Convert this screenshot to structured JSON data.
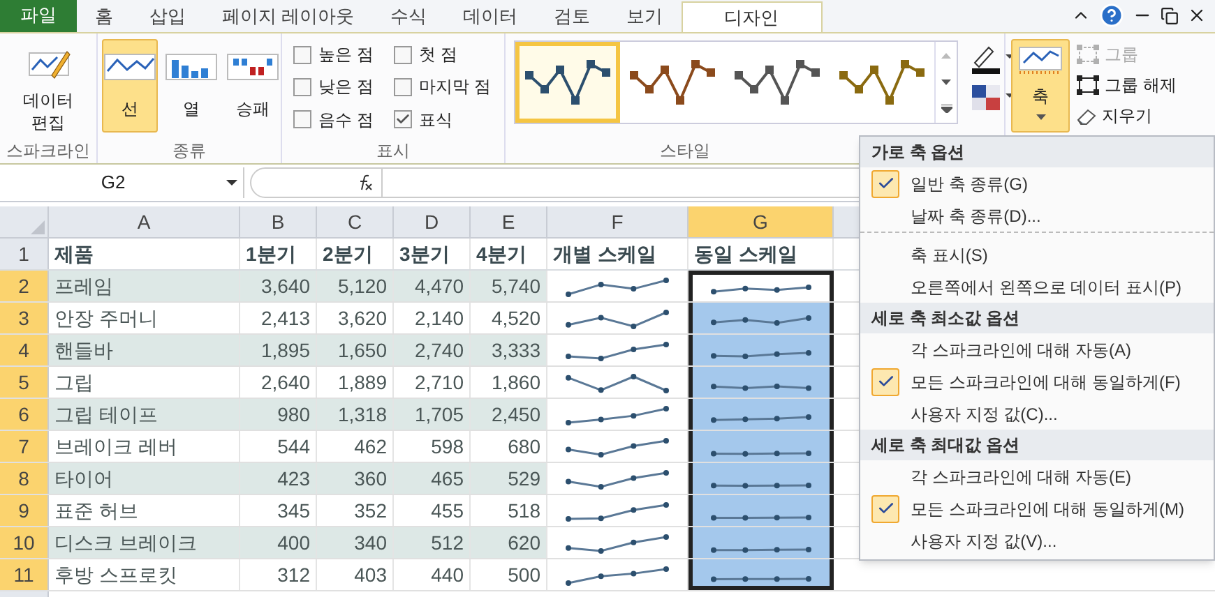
{
  "tabs": [
    {
      "label": "파일",
      "kind": "file",
      "selected": false
    },
    {
      "label": "홈",
      "kind": "tab",
      "selected": false
    },
    {
      "label": "삽입",
      "kind": "tab",
      "selected": false
    },
    {
      "label": "페이지 레이아웃",
      "kind": "tab",
      "selected": false
    },
    {
      "label": "수식",
      "kind": "tab",
      "selected": false
    },
    {
      "label": "데이터",
      "kind": "tab",
      "selected": false
    },
    {
      "label": "검토",
      "kind": "tab",
      "selected": false
    },
    {
      "label": "보기",
      "kind": "tab",
      "selected": false
    },
    {
      "label": "디자인",
      "kind": "tab",
      "selected": true
    }
  ],
  "ribbon": {
    "sparkline_group": {
      "button": "데이터 편집",
      "label": "스파크라인"
    },
    "type_group": {
      "label": "종류",
      "buttons": [
        {
          "label": "선",
          "kind": "line",
          "selected": true
        },
        {
          "label": "열",
          "kind": "column",
          "selected": false
        },
        {
          "label": "승패",
          "kind": "winloss",
          "selected": false
        }
      ]
    },
    "show_group": {
      "label": "표시",
      "checkboxes": [
        {
          "label": "높은 점",
          "checked": false
        },
        {
          "label": "낮은 점",
          "checked": false
        },
        {
          "label": "음수 점",
          "checked": false
        },
        {
          "label": "첫 점",
          "checked": false
        },
        {
          "label": "마지막 점",
          "checked": false
        },
        {
          "label": "표식",
          "checked": true
        }
      ]
    },
    "style_group": {
      "label": "스타일",
      "styles": [
        {
          "color": "#2c4f6e",
          "selected": true
        },
        {
          "color": "#8b4a1c",
          "selected": false
        },
        {
          "color": "#555555",
          "selected": false
        },
        {
          "color": "#8a6a10",
          "selected": false
        }
      ]
    },
    "axis_button": {
      "label": "축",
      "selected": true
    },
    "group_buttons": [
      {
        "label": "그룹",
        "kind": "group",
        "disabled": true
      },
      {
        "label": "그룹 해제",
        "kind": "ungroup",
        "disabled": false
      },
      {
        "label": "지우기",
        "kind": "clear",
        "disabled": false
      }
    ]
  },
  "name_box": "G2",
  "columns": [
    {
      "letter": "A",
      "selected": false
    },
    {
      "letter": "B",
      "selected": false
    },
    {
      "letter": "C",
      "selected": false
    },
    {
      "letter": "D",
      "selected": false
    },
    {
      "letter": "E",
      "selected": false
    },
    {
      "letter": "F",
      "selected": false
    },
    {
      "letter": "G",
      "selected": true
    }
  ],
  "header_row": {
    "number": "1",
    "cells": [
      "제품",
      "1분기",
      "2분기",
      "3분기",
      "4분기",
      "개별 스케일",
      "동일 스케일"
    ]
  },
  "rows": [
    {
      "number": "2",
      "selected": true,
      "cells": [
        "프레임",
        "3,640",
        "5,120",
        "4,470",
        "5,740"
      ]
    },
    {
      "number": "3",
      "selected": true,
      "cells": [
        "안장 주머니",
        "2,413",
        "3,620",
        "2,140",
        "4,520"
      ]
    },
    {
      "number": "4",
      "selected": true,
      "cells": [
        "핸들바",
        "1,895",
        "1,650",
        "2,740",
        "3,333"
      ]
    },
    {
      "number": "5",
      "selected": true,
      "cells": [
        "그립",
        "2,640",
        "1,889",
        "2,710",
        "1,860"
      ]
    },
    {
      "number": "6",
      "selected": true,
      "cells": [
        "그립 테이프",
        "980",
        "1,318",
        "1,705",
        "2,450"
      ]
    },
    {
      "number": "7",
      "selected": true,
      "cells": [
        "브레이크 레버",
        "544",
        "462",
        "598",
        "680"
      ]
    },
    {
      "number": "8",
      "selected": true,
      "cells": [
        "타이어",
        "423",
        "360",
        "465",
        "529"
      ]
    },
    {
      "number": "9",
      "selected": true,
      "cells": [
        "표준 허브",
        "345",
        "352",
        "455",
        "518"
      ]
    },
    {
      "number": "10",
      "selected": true,
      "cells": [
        "디스크 브레이크",
        "400",
        "340",
        "512",
        "620"
      ]
    },
    {
      "number": "11",
      "selected": true,
      "cells": [
        "후방 스프로킷",
        "312",
        "403",
        "440",
        "500"
      ]
    }
  ],
  "axis_menu": {
    "sections": [
      {
        "title": "가로 축 옵션",
        "items": [
          {
            "label": "일반 축 종류(G)",
            "checked": true
          },
          {
            "label": "날짜 축 종류(D)...",
            "checked": false,
            "separator_after": true
          },
          {
            "label": "축 표시(S)",
            "checked": false
          },
          {
            "label": "오른쪽에서 왼쪽으로 데이터 표시(P)",
            "checked": false
          }
        ]
      },
      {
        "title": "세로 축 최소값 옵션",
        "items": [
          {
            "label": "각 스파크라인에 대해 자동(A)",
            "checked": false
          },
          {
            "label": "모든 스파크라인에 대해 동일하게(F)",
            "checked": true
          },
          {
            "label": "사용자 지정 값(C)...",
            "checked": false
          }
        ]
      },
      {
        "title": "세로 축 최대값 옵션",
        "items": [
          {
            "label": "각 스파크라인에 대해 자동(E)",
            "checked": false
          },
          {
            "label": "모든 스파크라인에 대해 동일하게(M)",
            "checked": true
          },
          {
            "label": "사용자 지정 값(V)...",
            "checked": false
          }
        ]
      }
    ]
  }
}
